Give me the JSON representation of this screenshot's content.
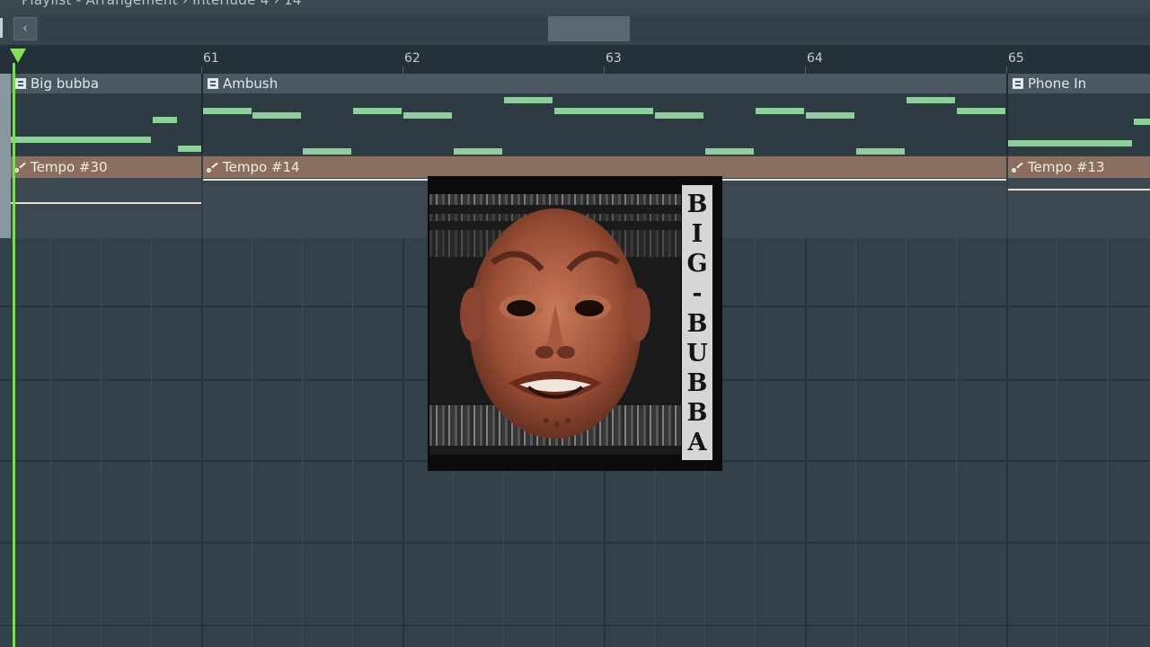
{
  "window": {
    "title": "Playlist - Arrangement › Interlude 4 › 14"
  },
  "scrollbar": {
    "left_button_glyph": "‹"
  },
  "ruler": {
    "bars": [
      "61",
      "62",
      "63",
      "64",
      "65"
    ]
  },
  "tracks": {
    "pattern_clips": [
      {
        "name": "Big bubba"
      },
      {
        "name": "Ambush"
      },
      {
        "name": "Phone In"
      }
    ],
    "automation_clips": [
      {
        "name": "Tempo #30"
      },
      {
        "name": "Tempo #14"
      },
      {
        "name": "Tempo #13"
      }
    ]
  },
  "album_art": {
    "title_letters": [
      "B",
      "I",
      "G",
      "-",
      "B",
      "U",
      "B",
      "B",
      "A"
    ]
  },
  "colors": {
    "playhead": "#7fd95a",
    "note": "#8fcf9d",
    "automation_clip": "#8a6f5e",
    "pattern_clip_header": "#4a5861"
  }
}
